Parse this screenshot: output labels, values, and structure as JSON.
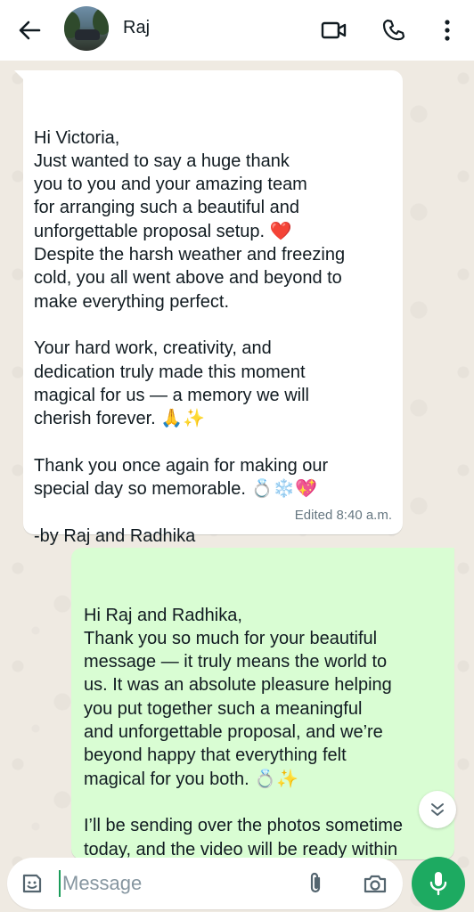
{
  "header": {
    "contact_name": "Raj",
    "icons": [
      "back-arrow-icon",
      "video-call-icon",
      "phone-icon",
      "more-vert-icon"
    ]
  },
  "messages": [
    {
      "direction": "incoming",
      "text": "Hi Victoria,\nJust wanted to say a huge thank\nyou to you and your amazing team\nfor arranging such a beautiful and\nunforgettable proposal setup. ❤️\nDespite the harsh weather and freezing\ncold, you all went above and beyond to\nmake everything perfect.\n\nYour hard work, creativity, and\ndedication truly made this moment\nmagical for us — a memory we will\ncherish forever. 🙏✨\n\nThank you once again for making our\nspecial day so memorable. 💍❄️💖\n\n-by Raj and Radhika",
      "meta": "Edited 8:40 a.m."
    },
    {
      "direction": "outgoing",
      "text": "Hi Raj and Radhika,\nThank you so much for your beautiful\nmessage — it truly means the world to\nus. It was an absolute pleasure helping\nyou put together such a meaningful\nand unforgettable proposal, and we’re\nbeyond happy that everything felt\nmagical for you both. 💍✨\n\nI’ll be sending over the photos sometime\ntoday, and the video will be ready within\nthe next two days after editing. I’ll make"
    }
  ],
  "composer": {
    "placeholder": "Message"
  },
  "colors": {
    "incoming_bubble": "#ffffff",
    "outgoing_bubble": "#d9fdd3",
    "chat_background": "#efeae2",
    "accent_green": "#1daa61",
    "meta_text": "#667781"
  }
}
